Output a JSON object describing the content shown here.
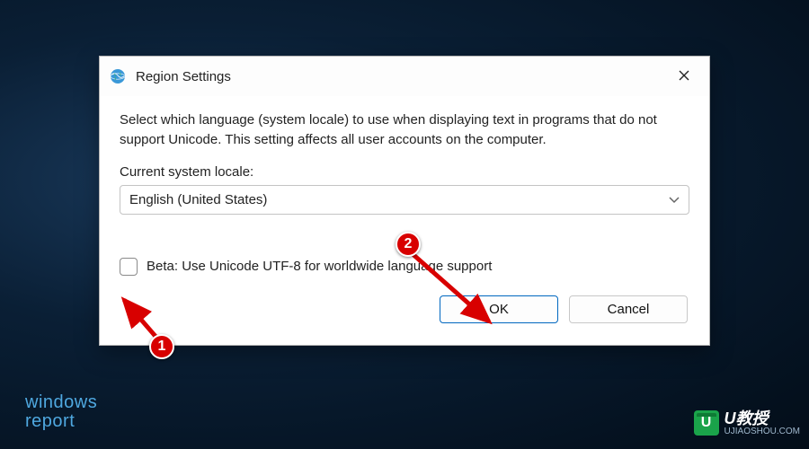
{
  "dialog": {
    "title": "Region Settings",
    "description": "Select which language (system locale) to use when displaying text in programs that do not support Unicode. This setting affects all user accounts on the computer.",
    "locale_label": "Current system locale:",
    "locale_value": "English (United States)",
    "checkbox_label": "Beta: Use Unicode UTF-8 for worldwide language support",
    "ok_label": "OK",
    "cancel_label": "Cancel"
  },
  "annotations": {
    "marker1": "1",
    "marker2": "2"
  },
  "watermarks": {
    "left_line1": "windows",
    "left_line2": "report",
    "right_badge": "U",
    "right_main": "U教授",
    "right_sub": "UJIAOSHOU.COM"
  }
}
